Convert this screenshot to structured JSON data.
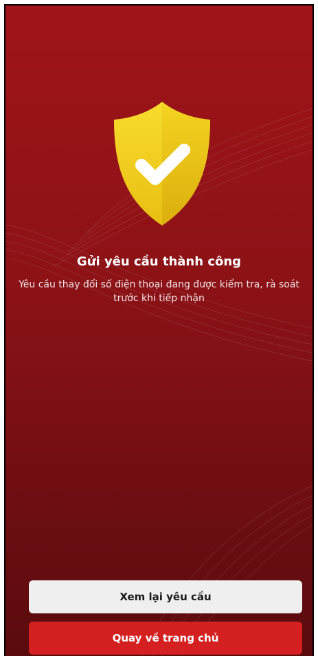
{
  "success": {
    "title": "Gửi yêu cầu thành công",
    "message": "Yêu cầu thay đổi số điện thoại đang được kiểm tra, rà soát trước khi tiếp nhận"
  },
  "actions": {
    "review_label": "Xem lại yêu cầu",
    "home_label": "Quay về trang chủ"
  },
  "icons": {
    "shield": "shield-check-icon"
  },
  "colors": {
    "background_top": "#a0141a",
    "background_bottom": "#5a0b0e",
    "shield": "#f3d21f",
    "primary_button": "#d42020",
    "secondary_button": "#efefef"
  }
}
